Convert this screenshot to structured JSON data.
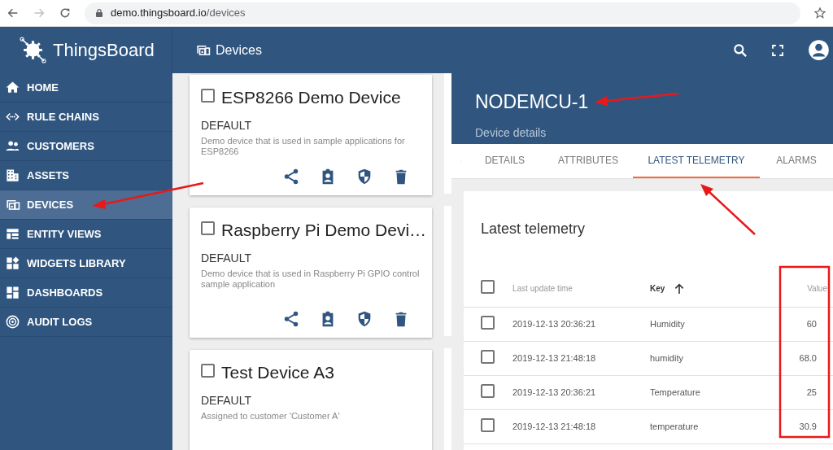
{
  "browser": {
    "url_host": "demo.thingsboard.io",
    "url_path": "/devices"
  },
  "app_bar": {
    "logo_text": "ThingsBoard",
    "page_title": "Devices"
  },
  "sidebar": {
    "items": [
      {
        "label": "HOME",
        "selected": false
      },
      {
        "label": "RULE CHAINS",
        "selected": false
      },
      {
        "label": "CUSTOMERS",
        "selected": false
      },
      {
        "label": "ASSETS",
        "selected": false
      },
      {
        "label": "DEVICES",
        "selected": true
      },
      {
        "label": "ENTITY VIEWS",
        "selected": false
      },
      {
        "label": "WIDGETS LIBRARY",
        "selected": false
      },
      {
        "label": "DASHBOARDS",
        "selected": false
      },
      {
        "label": "AUDIT LOGS",
        "selected": false
      }
    ]
  },
  "device_cards": [
    {
      "name": "ESP8266 Demo Device",
      "checked": false,
      "profile": "DEFAULT",
      "description": "Demo device that is used in sample applications for ESP8266"
    },
    {
      "name": "Raspberry Pi Demo Devi…",
      "checked": false,
      "profile": "DEFAULT",
      "description": "Demo device that is used in Raspberry Pi GPIO control sample application"
    },
    {
      "name": "Test Device A3",
      "checked": false,
      "profile": "DEFAULT",
      "description": "Assigned to customer 'Customer A'"
    }
  ],
  "details": {
    "title": "NODEMCU-1",
    "subtitle": "Device details",
    "tabs": [
      {
        "label": "DETAILS",
        "selected": false
      },
      {
        "label": "ATTRIBUTES",
        "selected": false
      },
      {
        "label": "LATEST TELEMETRY",
        "selected": true
      },
      {
        "label": "ALARMS",
        "selected": false
      }
    ],
    "telemetry": {
      "title": "Latest telemetry",
      "header_checked": false,
      "columns": [
        "Last update time",
        "Key",
        "Value"
      ],
      "rows": [
        {
          "checked": false,
          "time": "2019-12-13 20:36:21",
          "key": "Humidity",
          "value": "60"
        },
        {
          "checked": false,
          "time": "2019-12-13 21:48:18",
          "key": "humidity",
          "value": "68.0"
        },
        {
          "checked": false,
          "time": "2019-12-13 20:36:21",
          "key": "Temperature",
          "value": "25"
        },
        {
          "checked": false,
          "time": "2019-12-13 21:48:18",
          "key": "temperature",
          "value": "30.9"
        }
      ]
    }
  }
}
